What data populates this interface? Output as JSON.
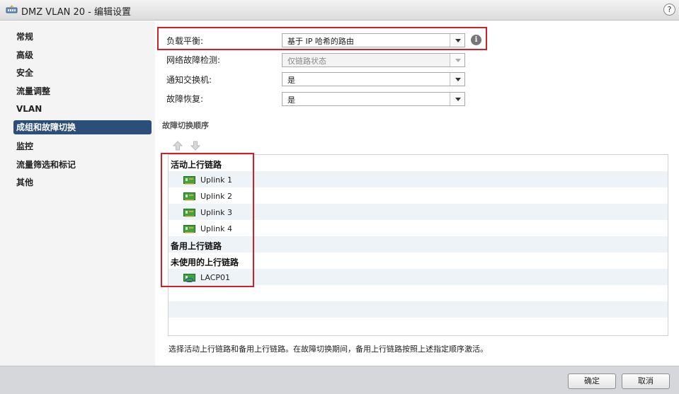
{
  "window": {
    "title": "DMZ VLAN 20 - 编辑设置",
    "help": "?"
  },
  "sidebar": {
    "items": [
      {
        "label": "常规"
      },
      {
        "label": "高级"
      },
      {
        "label": "安全"
      },
      {
        "label": "流量调整"
      },
      {
        "label": "VLAN"
      },
      {
        "label": "成组和故障切换",
        "selected": true
      },
      {
        "label": "监控"
      },
      {
        "label": "流量筛选和标记"
      },
      {
        "label": "其他"
      }
    ]
  },
  "form": {
    "load_balancing": {
      "label": "负载平衡:",
      "value": "基于 IP 哈希的路由"
    },
    "failure_detection": {
      "label": "网络故障检测:",
      "value": "仅链路状态",
      "disabled": true
    },
    "notify_switches": {
      "label": "通知交换机:",
      "value": "是"
    },
    "failback": {
      "label": "故障恢复:",
      "value": "是"
    },
    "info_icon": "i"
  },
  "failover_order": {
    "title": "故障切换顺序",
    "groups": {
      "active": "活动上行链路",
      "standby": "备用上行链路",
      "unused": "未使用的上行链路"
    },
    "active_uplinks": [
      "Uplink 1",
      "Uplink 2",
      "Uplink 3",
      "Uplink 4"
    ],
    "unused_uplinks": [
      "LACP01"
    ]
  },
  "hint": "选择活动上行链路和备用上行链路。在故障切换期间，备用上行链路按照上述指定顺序激活。",
  "footer": {
    "ok": "确定",
    "cancel": "取消"
  },
  "colors": {
    "selected_bg": "#2c4f79",
    "highlight_box": "#d0202a",
    "stripe": "#eef3f8"
  }
}
